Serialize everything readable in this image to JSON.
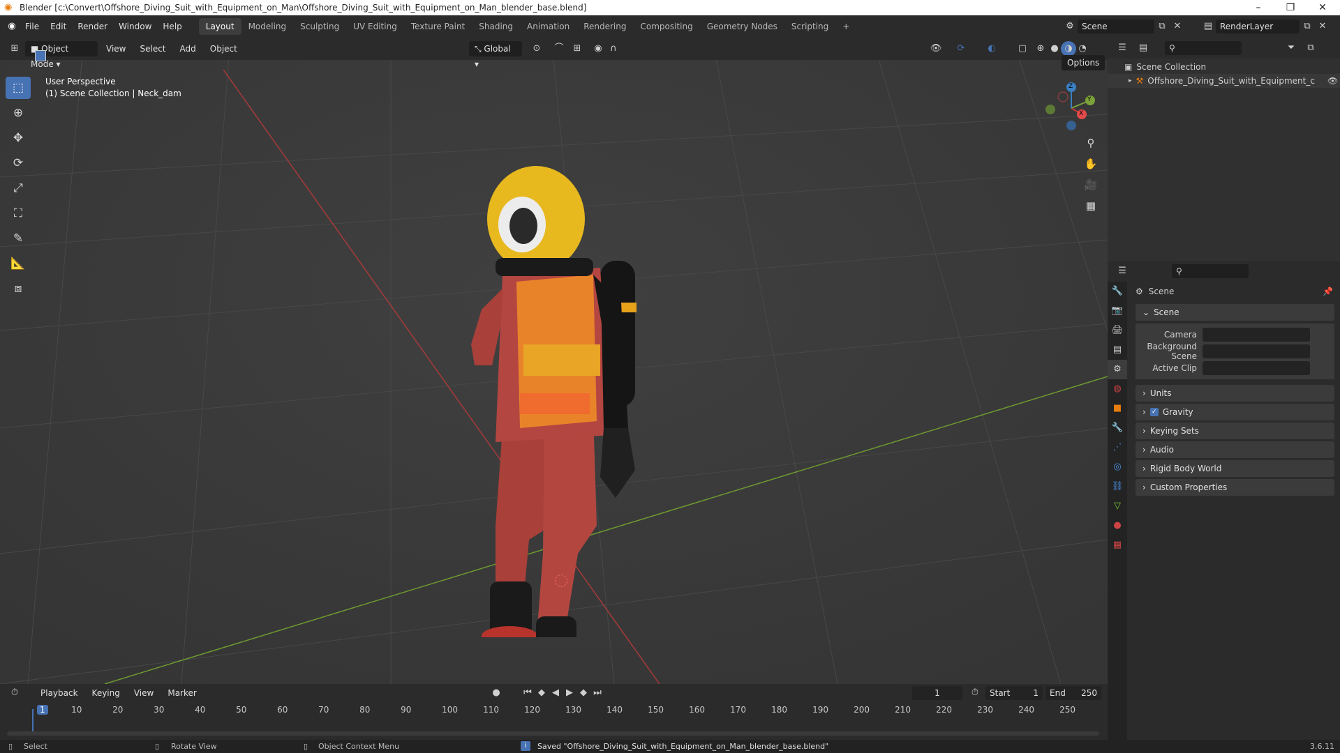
{
  "titlebar": {
    "title": "Blender [c:\\Convert\\Offshore_Diving_Suit_with_Equipment_on_Man\\Offshore_Diving_Suit_with_Equipment_on_Man_blender_base.blend]",
    "minimize": "–",
    "maximize": "❐",
    "close": "✕"
  },
  "menubar": {
    "items": [
      "File",
      "Edit",
      "Render",
      "Window",
      "Help"
    ],
    "workspaces": [
      "Layout",
      "Modeling",
      "Sculpting",
      "UV Editing",
      "Texture Paint",
      "Shading",
      "Animation",
      "Rendering",
      "Compositing",
      "Geometry Nodes",
      "Scripting"
    ],
    "active_workspace": "Layout",
    "add_tab": "+",
    "scene_name": "Scene",
    "render_layer": "RenderLayer"
  },
  "viewport_header": {
    "mode": "Object Mode",
    "menus": [
      "View",
      "Select",
      "Add",
      "Object"
    ],
    "transform_orientation": "Global",
    "options": "Options"
  },
  "viewport": {
    "perspective_label": "User Perspective",
    "collection_label": "(1) Scene Collection | Neck_dam",
    "axis_x": "X",
    "axis_y": "Y",
    "axis_z": "Z"
  },
  "outliner": {
    "root": "Scene Collection",
    "item": "Offshore_Diving_Suit_with_Equipment_c"
  },
  "properties": {
    "header": "Scene",
    "section": "Scene",
    "fields": [
      {
        "label": "Camera"
      },
      {
        "label": "Background Scene"
      },
      {
        "label": "Active Clip"
      }
    ],
    "panels": [
      "Units",
      "Gravity",
      "Keying Sets",
      "Audio",
      "Rigid Body World",
      "Custom Properties"
    ],
    "gravity_checked": true
  },
  "timeline": {
    "menus": [
      "Playback",
      "Keying",
      "View",
      "Marker"
    ],
    "current_frame": "1",
    "start_label": "Start",
    "start": "1",
    "end_label": "End",
    "end": "250",
    "ticks": [
      "1",
      "10",
      "20",
      "30",
      "40",
      "50",
      "60",
      "70",
      "80",
      "90",
      "100",
      "110",
      "120",
      "130",
      "140",
      "150",
      "160",
      "170",
      "180",
      "190",
      "200",
      "210",
      "220",
      "230",
      "240",
      "250"
    ]
  },
  "statusbar": {
    "select": "Select",
    "rotate": "Rotate View",
    "context": "Object Context Menu",
    "message": "Saved \"Offshore_Diving_Suit_with_Equipment_on_Man_blender_base.blend\"",
    "version": "3.6.11"
  },
  "colors": {
    "accent": "#4772b3",
    "x_axis": "#c23b3b",
    "y_axis": "#7ca23a",
    "suit": "#b8443e",
    "helmet": "#e8b91f",
    "vest": "#e87d1f"
  }
}
